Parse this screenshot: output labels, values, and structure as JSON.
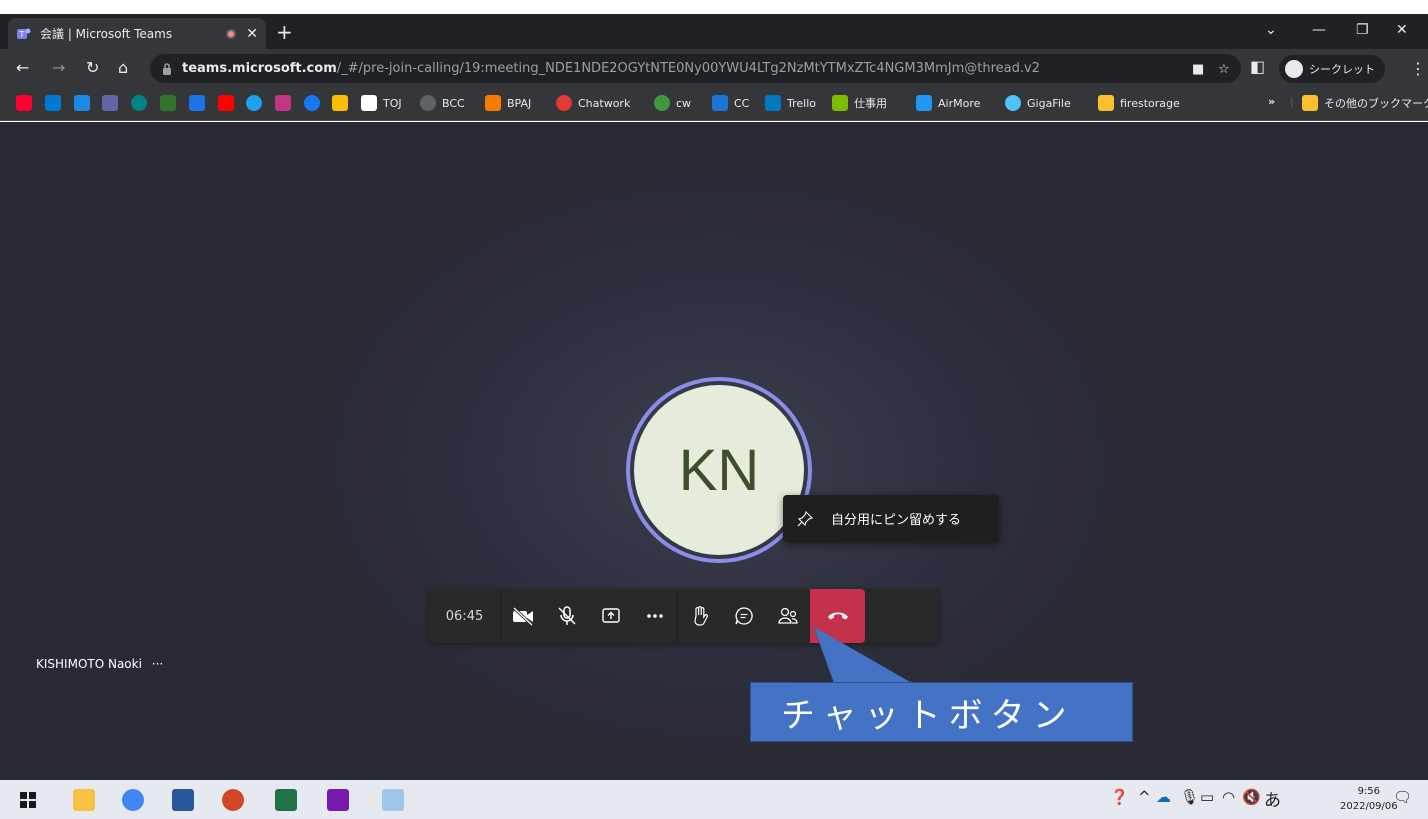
{
  "browser": {
    "tab_title": "会議 | Microsoft Teams",
    "url_host": "teams.microsoft.com",
    "url_path": "/_#/pre-join-calling/19:meeting_NDE1NDE2OGYtNTE0Ny00YWU4LTg2NzMtYTMxZTc4NGM3MmJm@thread.v2",
    "incognito_label": "シークレット",
    "icons": [
      "back-icon",
      "forward-icon",
      "reload-icon",
      "home-icon",
      "lock-icon",
      "camera-icon",
      "star-icon",
      "sidepanel-icon",
      "menu-icon"
    ]
  },
  "bookmarks": {
    "items": [
      {
        "label": "TOJ"
      },
      {
        "label": "BCC"
      },
      {
        "label": "BPAJ"
      },
      {
        "label": "Chatwork"
      },
      {
        "label": "cw"
      },
      {
        "label": "CC"
      },
      {
        "label": "Trello"
      },
      {
        "label": "仕事用"
      },
      {
        "label": "AirMore"
      },
      {
        "label": "GigaFile"
      },
      {
        "label": "firestorage"
      }
    ],
    "overflow": "»",
    "other": "その他のブックマーク"
  },
  "meeting": {
    "avatar_initials": "KN",
    "pin_menu_label": "自分用にピン留めする",
    "timer": "06:45",
    "participant_name": "KISHIMOTO Naoki",
    "participant_more": "···",
    "callout_text": "チャットボタン"
  },
  "taskbar": {
    "time": "9:56",
    "date": "2022/09/06",
    "ime": "あ"
  },
  "colors": {
    "hangup": "#c4314b",
    "avatar_ring": "#8b8ee8",
    "callout": "#4472c4"
  }
}
